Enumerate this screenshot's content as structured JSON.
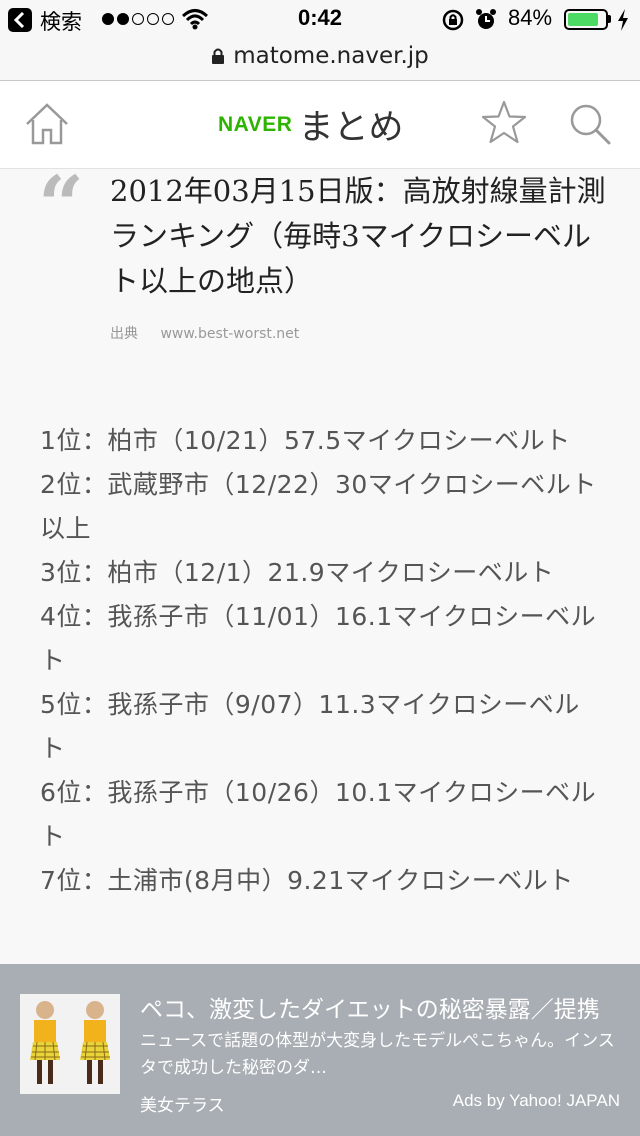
{
  "status_bar": {
    "back_app": "検索",
    "signal_dots": [
      true,
      true,
      false,
      false,
      false
    ],
    "time": "0:42",
    "battery_percent": "84%",
    "battery_level": 0.84,
    "battery_color": "#4cd964"
  },
  "browser": {
    "url": "matome.naver.jp"
  },
  "header": {
    "logo_naver": "NAVER",
    "logo_matome": "まとめ",
    "brand_color": "#2db400",
    "icons": [
      "home-icon",
      "star-icon",
      "search-icon"
    ]
  },
  "article": {
    "quote_mark": "“",
    "quote_title": "2012年03月15日版：高放射線量計測ランキング（毎時3マイクロシーベルト以上の地点）",
    "source_label": "出典",
    "source_url": "www.best-worst.net",
    "rankings": [
      "1位：柏市（10/21）57.5マイクロシーベルト",
      "2位：武蔵野市（12/22）30マイクロシーベルト以上",
      "3位：柏市（12/1）21.9マイクロシーベルト",
      "4位：我孫子市（11/01）16.1マイクロシーベルト",
      "5位：我孫子市（9/07）11.3マイクロシーベルト",
      "6位：我孫子市（10/26）10.1マイクロシーベルト",
      "7位：土浦市(8月中）9.21マイクロシーベルト"
    ]
  },
  "ad": {
    "title": "ペコ、激変したダイエットの秘密暴露／提携",
    "description": "ニュースで話題の体型が大変身したモデルぺこちゃん。インスタで成功した秘密のダ…",
    "source": "美女テラス",
    "credit": "Ads by Yahoo! JAPAN"
  }
}
